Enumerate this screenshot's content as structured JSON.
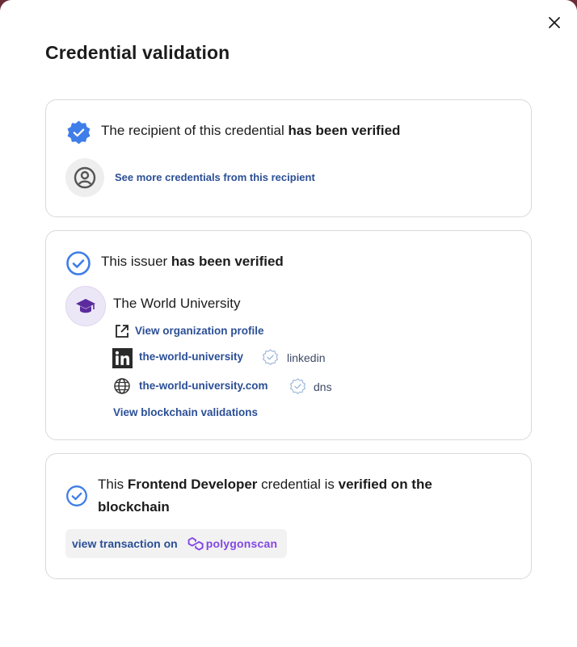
{
  "title": "Credential validation",
  "recipient_card": {
    "text_prefix": "The recipient of this credential ",
    "text_bold": "has been verified",
    "link": "See more credentials from this recipient"
  },
  "issuer_card": {
    "text_prefix": "This issuer ",
    "text_bold": "has been verified",
    "org_name": "The World University",
    "profile_link": "View organization profile",
    "linkedin": {
      "handle": "the-world-university",
      "source": "linkedin"
    },
    "dns": {
      "domain": "the-world-university.com",
      "source": "dns"
    },
    "blockchain_link": "View blockchain validations"
  },
  "credential_card": {
    "text_1": "This ",
    "text_bold_1": "Frontend Developer",
    "text_2": " credential is ",
    "text_bold_2": "verified on the",
    "text_bold_3": "blockchain",
    "tx_label": "view transaction on",
    "tx_brand": "polygonscan"
  },
  "colors": {
    "accent": "#2b4f96",
    "verified_blue": "#3f7de8",
    "polygon_purple": "#8247e5",
    "university_purple": "#5b2b9e"
  }
}
